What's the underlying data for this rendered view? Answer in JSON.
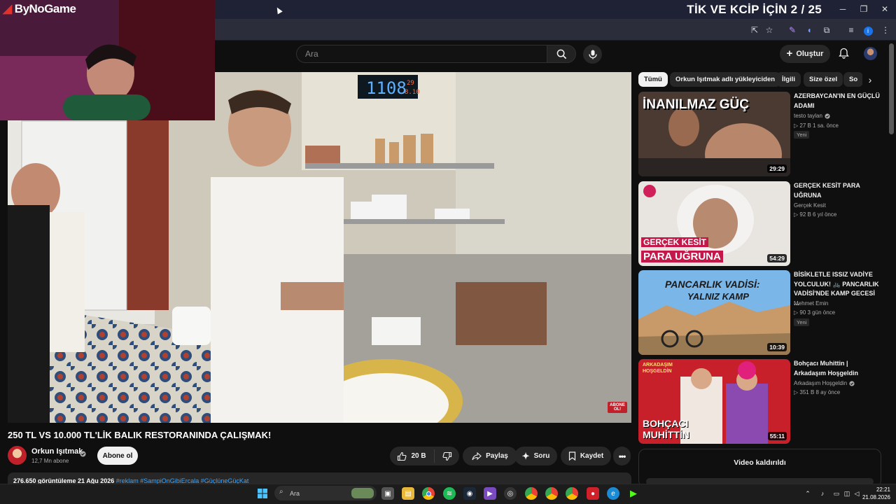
{
  "overlay": {
    "title": "TİK VE KCİP İÇİN 2 / 25",
    "streamer_logo": "ByNoGame"
  },
  "header": {
    "search_placeholder": "Ara",
    "create_label": "Oluştur"
  },
  "player": {
    "overlay_badge": "ABONE OL!"
  },
  "video": {
    "title": "250 TL VS 10.000 TL'LİK BALIK RESTORANINDA ÇALIŞMAK!",
    "channel": "Orkun Işıtmak",
    "subscribers": "12,7 Mn abone",
    "subscribe_label": "Abone ol",
    "likes": "20 B",
    "share_label": "Paylaş",
    "ask_label": "Soru",
    "save_label": "Kaydet",
    "description_stats": "276.650 görüntüleme  21 Ağu 2026",
    "description_tags": "#reklam #SampiOnGibiErcala #GüçlüneGüçKat"
  },
  "chips": [
    {
      "label": "Tümü",
      "active": true
    },
    {
      "label": "Orkun Işıtmak adlı yükleyiciden",
      "active": false
    },
    {
      "label": "İlgili",
      "active": false
    },
    {
      "label": "Size özel",
      "active": false
    },
    {
      "label": "So",
      "active": false
    }
  ],
  "recommendations": [
    {
      "title": "AZERBAYCAN'IN EN GÜÇLÜ ADAMI",
      "channel": "testo taylan",
      "verified": true,
      "meta": "▷ 27 B   1 sa. önce",
      "badge": "Yeni",
      "duration": "29:29",
      "thumb_text": "İNANILMAZ GÜÇ"
    },
    {
      "title": "GERÇEK KESİT   PARA UĞRUNA",
      "channel": "Gerçek Kesit",
      "verified": false,
      "meta": "▷ 92 B   6 yıl önce",
      "badge": "",
      "duration": "54:29",
      "thumb_text_1": "GERÇEK KESİT",
      "thumb_text_2": "PARA UĞRUNA"
    },
    {
      "title": "BİSİKLETLE ISSIZ VADİYE YOLCULUK! 🚲 PANCARLIK VADİSİ'NDE KAMP GECESİ ...",
      "channel": "Mehmet Emin",
      "verified": false,
      "meta": "▷ 90   3 gün önce",
      "badge": "Yeni",
      "duration": "10:39",
      "thumb_text_1": "PANCARLIK VADİSİ:",
      "thumb_text_2": "YALNIZ KAMP"
    },
    {
      "title": "Bohçacı Muhittin | Arkadaşım Hoşgeldin",
      "channel": "Arkadaşım Hoşgeldin",
      "verified": true,
      "meta": "▷ 351 B   8 ay önce",
      "badge": "",
      "duration": "55:11",
      "thumb_text_1": "ARKADAŞIM HOŞGELDİN",
      "thumb_text_2": "BOHÇACI MUHİTTİN"
    }
  ],
  "sidebar": {
    "video_removed": "Video kaldırıldı"
  },
  "taskbar": {
    "search_placeholder": "Ara",
    "time": "22:21",
    "date": "21.08.2026"
  },
  "player_clock": {
    "time": "1108",
    "small_top": "29",
    "small_bottom": "8.10"
  }
}
